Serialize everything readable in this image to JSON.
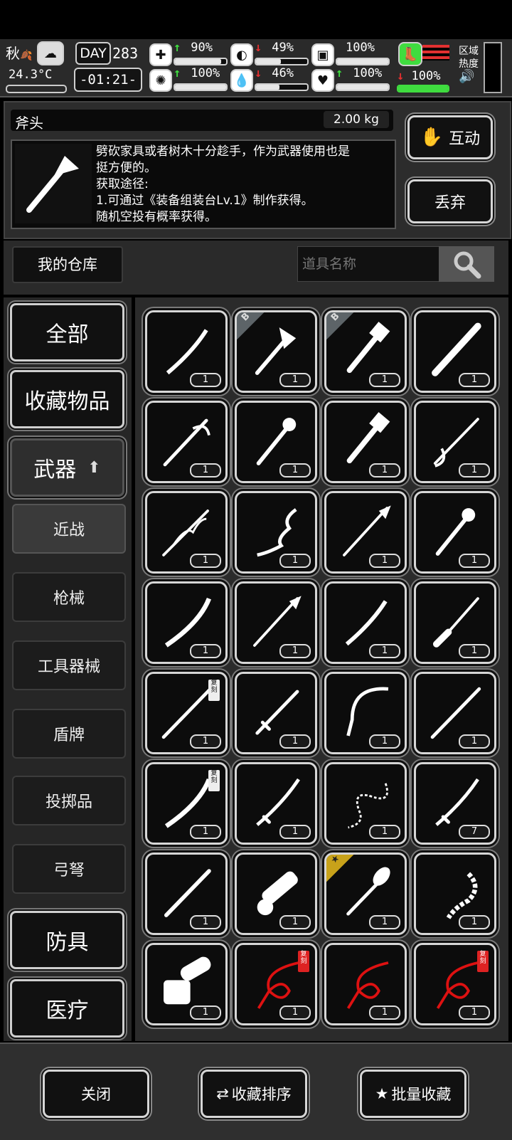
{
  "status": {
    "season": "秋",
    "temperature": "24.3°C",
    "day_label": "DAY",
    "day_value": "283",
    "time": "-01:21-",
    "stats": [
      {
        "icon": "medkit-icon",
        "arrow": "up",
        "value": "90%",
        "fill": 0.9
      },
      {
        "icon": "stomach-icon",
        "arrow": "down",
        "value": "49%",
        "fill": 0.49
      },
      {
        "icon": "stamina-icon",
        "arrow": "",
        "value": "100%",
        "fill": 1.0
      },
      {
        "icon": "brain-icon",
        "arrow": "up",
        "value": "100%",
        "fill": 1.0
      },
      {
        "icon": "water-icon",
        "arrow": "down",
        "value": "46%",
        "fill": 0.46
      },
      {
        "icon": "heart-icon",
        "arrow": "up",
        "value": "100%",
        "fill": 1.0
      }
    ],
    "boot_value": "100%",
    "boot_fill": 1.0,
    "zone_label_1": "区域",
    "zone_label_2": "热度",
    "accent_green": "#3fdc3f",
    "accent_red": "#e23030"
  },
  "item": {
    "name": "斧头",
    "weight": "2.00 kg",
    "description": [
      "劈砍家具或者树木十分趁手，作为武器使用也是",
      "挺方便的。",
      "获取途径:",
      "1.可通过《装备组装台Lv.1》制作获得。",
      "随机空投有概率获得。"
    ],
    "interact_label": "互动",
    "discard_label": "丢弃"
  },
  "warehouse": {
    "title": "我的仓库",
    "search_placeholder": "道具名称"
  },
  "categories": {
    "all": "全部",
    "favorites": "收藏物品",
    "weapons": "武器",
    "melee": "近战",
    "guns": "枪械",
    "tools": "工具器械",
    "shields": "盾牌",
    "throwables": "投掷品",
    "bows": "弓弩",
    "armor": "防具",
    "medical": "医疗"
  },
  "grid": {
    "items": [
      {
        "icon": "machete-icon",
        "qty": "1"
      },
      {
        "icon": "axe-icon",
        "qty": "1",
        "badge": "B"
      },
      {
        "icon": "sledgehammer-icon",
        "qty": "1",
        "badge": "B"
      },
      {
        "icon": "saw-machete-icon",
        "qty": "1"
      },
      {
        "icon": "saber-icon",
        "qty": "1"
      },
      {
        "icon": "spiked-club-icon",
        "qty": "1"
      },
      {
        "icon": "sledgehammer-icon",
        "qty": "1"
      },
      {
        "icon": "ornate-spear-icon",
        "qty": "1"
      },
      {
        "icon": "vine-staff-icon",
        "qty": "1"
      },
      {
        "icon": "serpent-sword-icon",
        "qty": "1"
      },
      {
        "icon": "trident-spear-icon",
        "qty": "1"
      },
      {
        "icon": "spiked-club-icon",
        "qty": "1"
      },
      {
        "icon": "vine-blade-icon",
        "qty": "1"
      },
      {
        "icon": "trident-spear-icon",
        "qty": "1"
      },
      {
        "icon": "machete-icon",
        "qty": "1"
      },
      {
        "icon": "knife-icon",
        "qty": "1"
      },
      {
        "icon": "long-sword-icon",
        "qty": "1",
        "tag": "复刻"
      },
      {
        "icon": "short-sword-icon",
        "qty": "1"
      },
      {
        "icon": "scythe-icon",
        "qty": "1"
      },
      {
        "icon": "long-sword-icon",
        "qty": "1"
      },
      {
        "icon": "vine-blade-icon",
        "qty": "1",
        "tag": "复刻"
      },
      {
        "icon": "katana-icon",
        "qty": "1"
      },
      {
        "icon": "chain-whip-icon",
        "qty": "1"
      },
      {
        "icon": "katana-icon",
        "qty": "7"
      },
      {
        "icon": "baseball-bat-icon",
        "qty": "1"
      },
      {
        "icon": "dragon-chainsaw-icon",
        "qty": "1"
      },
      {
        "icon": "shovel-icon",
        "qty": "1",
        "badge": "★",
        "gold": true
      },
      {
        "icon": "bone-whip-icon",
        "qty": "1"
      },
      {
        "icon": "chainsaw-icon",
        "qty": "1"
      },
      {
        "icon": "red-whip-icon",
        "qty": "1",
        "tag": "复刻",
        "red": true
      },
      {
        "icon": "red-whip-icon",
        "qty": "1"
      },
      {
        "icon": "red-whip-icon",
        "qty": "1",
        "tag": "复刻",
        "red": true
      }
    ]
  },
  "bottom": {
    "close_label": "关闭",
    "sort_label": "收藏排序",
    "batch_label": "批量收藏"
  }
}
